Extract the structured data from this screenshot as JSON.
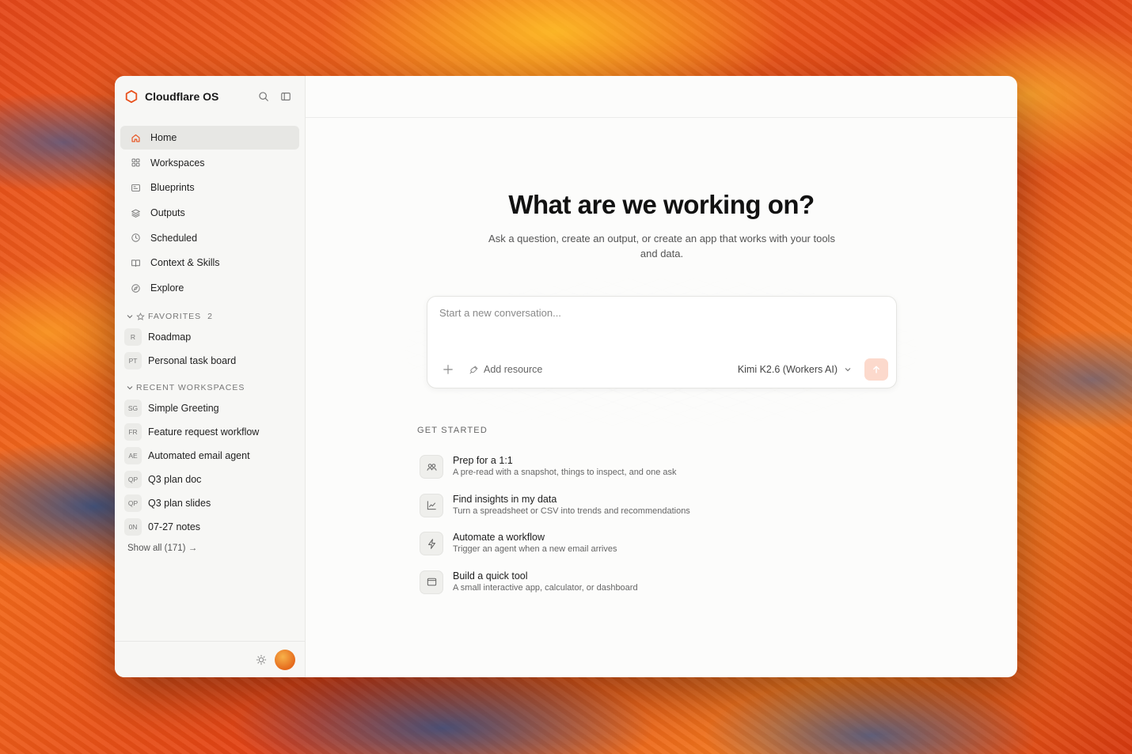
{
  "app": {
    "title": "Cloudflare OS",
    "accent_color": "#f38020"
  },
  "sidebar": {
    "nav": [
      {
        "label": "Home",
        "icon": "home-icon",
        "active": true
      },
      {
        "label": "Workspaces",
        "icon": "grid-icon"
      },
      {
        "label": "Blueprints",
        "icon": "blueprint-icon"
      },
      {
        "label": "Outputs",
        "icon": "layers-icon"
      },
      {
        "label": "Scheduled",
        "icon": "clock-icon"
      },
      {
        "label": "Context & Skills",
        "icon": "book-icon"
      },
      {
        "label": "Explore",
        "icon": "compass-icon"
      }
    ],
    "favorites": {
      "label": "FAVORITES",
      "count": "2",
      "items": [
        {
          "badge": "R",
          "label": "Roadmap"
        },
        {
          "badge": "PT",
          "label": "Personal task board"
        }
      ]
    },
    "recent": {
      "label": "RECENT WORKSPACES",
      "items": [
        {
          "badge": "SG",
          "label": "Simple Greeting"
        },
        {
          "badge": "FR",
          "label": "Feature request workflow"
        },
        {
          "badge": "AE",
          "label": "Automated email agent"
        },
        {
          "badge": "QP",
          "label": "Q3 plan doc"
        },
        {
          "badge": "QP",
          "label": "Q3 plan slides"
        },
        {
          "badge": "0N",
          "label": "07-27 notes"
        }
      ],
      "show_all": "Show all (171) →"
    }
  },
  "main": {
    "title": "What are we working on?",
    "subtitle": "Ask a question, create an output, or create an app that works with your tools and data.",
    "composer": {
      "placeholder": "Start a new conversation...",
      "value": "",
      "add_resource": "Add resource",
      "model": "Kimi K2.6 (Workers AI)"
    },
    "get_started": {
      "label": "GET STARTED",
      "items": [
        {
          "title": "Prep for a 1:1",
          "desc": "A pre-read with a snapshot, things to inspect, and one ask",
          "icon": "people-icon"
        },
        {
          "title": "Find insights in my data",
          "desc": "Turn a spreadsheet or CSV into trends and recommendations",
          "icon": "chart-icon"
        },
        {
          "title": "Automate a workflow",
          "desc": "Trigger an agent when a new email arrives",
          "icon": "bolt-icon"
        },
        {
          "title": "Build a quick tool",
          "desc": "A small interactive app, calculator, or dashboard",
          "icon": "window-icon"
        }
      ]
    }
  }
}
